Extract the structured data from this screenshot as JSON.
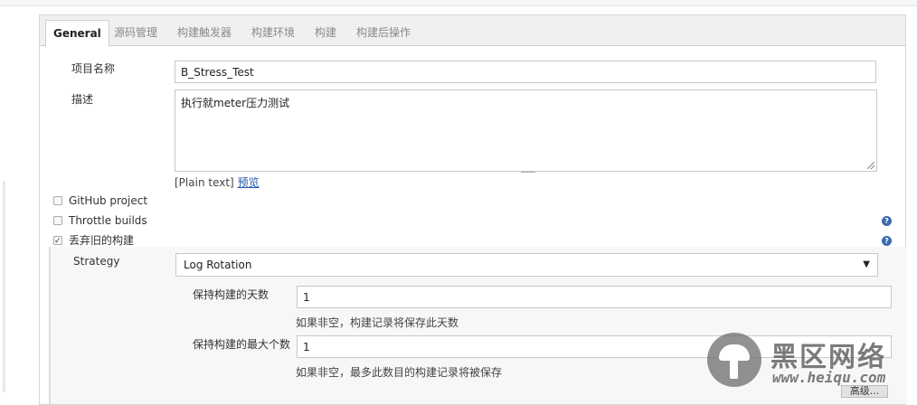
{
  "tabs": [
    {
      "label": "General"
    },
    {
      "label": "源码管理"
    },
    {
      "label": "构建触发器"
    },
    {
      "label": "构建环境"
    },
    {
      "label": "构建"
    },
    {
      "label": "构建后操作"
    }
  ],
  "general": {
    "project_name_label": "项目名称",
    "project_name_value": "B_Stress_Test",
    "description_label": "描述",
    "description_value": "执行就meter压力测试",
    "plain_text": "[Plain text]",
    "preview_link": "预览"
  },
  "options": [
    {
      "label": "GitHub project",
      "checked": false
    },
    {
      "label": "Throttle builds",
      "checked": false
    },
    {
      "label": "丢弃旧的构建",
      "checked": true
    }
  ],
  "help_glyph": "?",
  "discard": {
    "strategy_label": "Strategy",
    "strategy_value": "Log Rotation",
    "strategy_arrow": "▼",
    "days_label": "保持构建的天数",
    "days_value": "1",
    "days_hint": "如果非空，构建记录将保存此天数",
    "max_label": "保持构建的最大个数",
    "max_value": "1",
    "max_hint": "如果非空，最多此数目的构建记录将被保存",
    "advanced_button": "高级..."
  },
  "watermark": {
    "title": "黑区网络",
    "url": "www.heiqu.com"
  }
}
